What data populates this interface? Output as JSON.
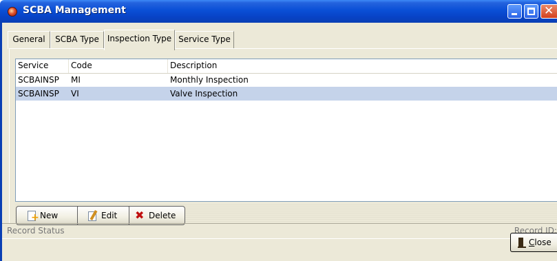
{
  "window": {
    "title": "SCBA Management",
    "icons": {
      "app": "fire-helmet-icon",
      "minimize": "minimize-icon",
      "maximize": "maximize-icon",
      "close": "close-x-icon"
    }
  },
  "tabs": [
    {
      "label": "General"
    },
    {
      "label": "SCBA Type"
    },
    {
      "label": "Inspection Type",
      "active": true
    },
    {
      "label": "Service Type"
    }
  ],
  "list": {
    "columns": [
      "Service",
      "Code",
      "Description"
    ],
    "rows": [
      {
        "service": "SCBAINSP",
        "code": "MI",
        "description": "Monthly Inspection"
      },
      {
        "service": "SCBAINSP",
        "code": "VI",
        "description": "Valve Inspection",
        "selected": true
      }
    ]
  },
  "toolbar": {
    "new_label": "New",
    "edit_label": "Edit",
    "delete_label": "Delete"
  },
  "status": {
    "left_label": "Record Status",
    "right_label": "Record ID:"
  },
  "footer": {
    "close_prefix": "C",
    "close_rest": "lose"
  },
  "colors": {
    "titlebar": "#0a4fd6",
    "window_bg": "#ece9d8",
    "selected_row": "#c5d3ea"
  }
}
